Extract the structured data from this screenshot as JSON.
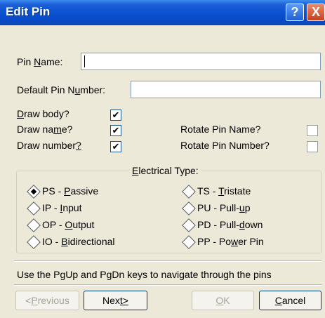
{
  "window": {
    "title": "Edit Pin"
  },
  "titlebar": {
    "help_glyph": "?",
    "close_glyph": "X",
    "help_icon": "help-icon",
    "close_icon": "close-icon"
  },
  "fields": {
    "pin_name": {
      "label_pre": "Pin ",
      "label_key": "N",
      "label_post": "ame:",
      "value": ""
    },
    "default_pin_number": {
      "label_pre": "Default Pin N",
      "label_key": "u",
      "label_post": "mber:",
      "value": ""
    }
  },
  "options": {
    "draw_body": {
      "label_key": "D",
      "label_post": "raw body?",
      "checked": true
    },
    "draw_name": {
      "label_pre": "Draw na",
      "label_key": "m",
      "label_post": "e?",
      "checked": true
    },
    "draw_number": {
      "label_pre": "Draw number",
      "label_key": "?",
      "label_post": "",
      "checked": true
    },
    "rotate_pin_name": {
      "label": "Rotate Pin Name?",
      "checked": false
    },
    "rotate_pin_number": {
      "label": "Rotate Pin Number?",
      "checked": false
    }
  },
  "electrical_type": {
    "title_key": "E",
    "title_post": "lectrical Type:",
    "items": [
      {
        "pre": "PS - ",
        "key": "P",
        "post": "assive",
        "checked": true
      },
      {
        "pre": "IP - ",
        "key": "I",
        "post": "nput",
        "checked": false
      },
      {
        "pre": "OP - ",
        "key": "O",
        "post": "utput",
        "checked": false
      },
      {
        "pre": "IO - ",
        "key": "B",
        "post": "idirectional",
        "checked": false
      },
      {
        "pre": "TS - ",
        "key": "T",
        "post": "ristate",
        "checked": false
      },
      {
        "pre": "PU - Pull-",
        "key": "u",
        "post": "p",
        "checked": false
      },
      {
        "pre": "PD - Pull-",
        "key": "d",
        "post": "own",
        "checked": false
      },
      {
        "pre": "PP - Po",
        "key": "w",
        "post": "er Pin",
        "checked": false
      }
    ]
  },
  "hint": "Use the PgUp and PgDn keys to navigate through the pins",
  "buttons": {
    "previous": {
      "pre": "<",
      "key": "P",
      "post": "revious",
      "enabled": false
    },
    "next": {
      "pre": "Nex",
      "key": "t>",
      "post": "",
      "enabled": true
    },
    "ok": {
      "pre": "",
      "key": "O",
      "post": "K",
      "enabled": false
    },
    "cancel": {
      "pre": "",
      "key": "C",
      "post": "ancel",
      "enabled": true
    }
  },
  "colors": {
    "title_bar": "#0a50d0",
    "dialog_bg": "#ece9d8"
  }
}
